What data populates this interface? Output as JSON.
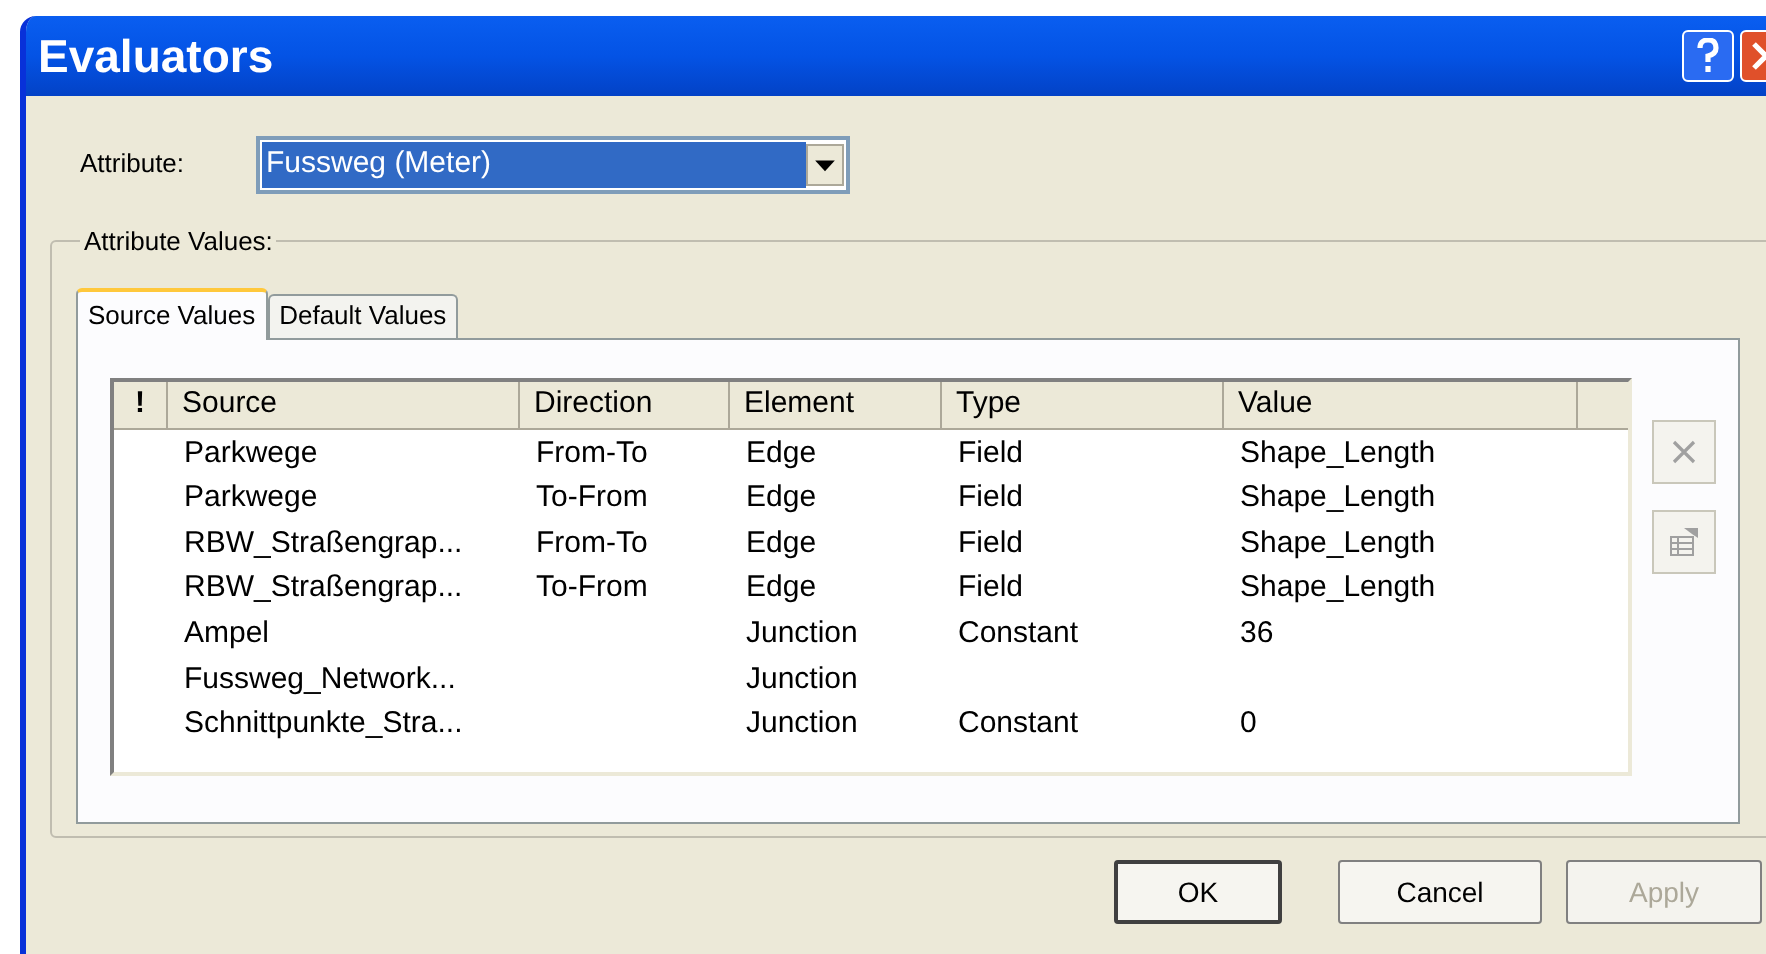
{
  "window": {
    "title": "Evaluators"
  },
  "attribute": {
    "label": "Attribute:",
    "value": "Fussweg (Meter)",
    "highlighted": true
  },
  "group": {
    "title": "Attribute Values:"
  },
  "tabs": [
    {
      "label": "Source Values",
      "selected": true
    },
    {
      "label": "Default Values",
      "selected": false
    }
  ],
  "table": {
    "columns": [
      "!",
      "Source",
      "Direction",
      "Element",
      "Type",
      "Value"
    ],
    "rows": [
      [
        "",
        "Parkwege",
        "From-To",
        "Edge",
        "Field",
        "Shape_Length"
      ],
      [
        "",
        "Parkwege",
        "To-From",
        "Edge",
        "Field",
        "Shape_Length"
      ],
      [
        "",
        "RBW_Straßengrap...",
        "From-To",
        "Edge",
        "Field",
        "Shape_Length"
      ],
      [
        "",
        "RBW_Straßengrap...",
        "To-From",
        "Edge",
        "Field",
        "Shape_Length"
      ],
      [
        "",
        "Ampel",
        "",
        "Junction",
        "Constant",
        "36"
      ],
      [
        "",
        "Fussweg_Network...",
        "",
        "Junction",
        "",
        ""
      ],
      [
        "",
        "Schnittpunkte_Stra...",
        "",
        "Junction",
        "Constant",
        "0"
      ]
    ]
  },
  "side_tools": [
    {
      "kind": "remove",
      "disabled": true
    },
    {
      "kind": "properties",
      "disabled": true
    }
  ],
  "buttons": [
    {
      "label": "OK",
      "disabled": false,
      "default": true
    },
    {
      "label": "Cancel",
      "disabled": false,
      "default": false
    },
    {
      "label": "Apply",
      "disabled": true,
      "default": false
    }
  ]
}
